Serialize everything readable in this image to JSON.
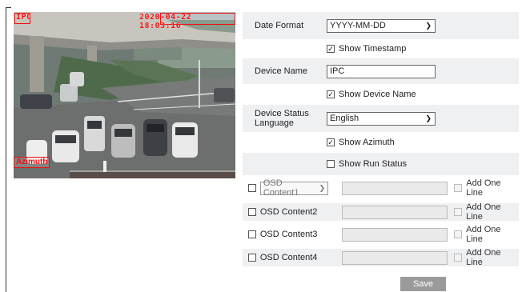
{
  "preview": {
    "channel_label": "IPC",
    "timestamp_text": "2020-04-22 18:03:16",
    "azimuth_label": "Azimuth"
  },
  "settings": {
    "date_format": {
      "label": "Date Format",
      "value": "YYYY-MM-DD"
    },
    "show_timestamp": {
      "label": "Show Timestamp",
      "checked": true
    },
    "device_name": {
      "label": "Device Name",
      "value": "IPC"
    },
    "show_device_name": {
      "label": "Show Device Name",
      "checked": true
    },
    "status_language": {
      "label": "Device Status Language",
      "value": "English"
    },
    "show_azimuth": {
      "label": "Show Azimuth",
      "checked": true
    },
    "show_run_status": {
      "label": "Show Run Status",
      "checked": false
    }
  },
  "osd": {
    "content1": {
      "select_value": "OSD Content1",
      "add_label": "Add One Line"
    },
    "content2": {
      "name": "OSD Content2",
      "add_label": "Add One Line"
    },
    "content3": {
      "name": "OSD Content3",
      "add_label": "Add One Line"
    },
    "content4": {
      "name": "OSD Content4",
      "add_label": "Add One Line"
    }
  },
  "actions": {
    "save_label": "Save"
  },
  "icons": {
    "checked": "check-mark",
    "dropdown": "chevron-down-icon"
  }
}
